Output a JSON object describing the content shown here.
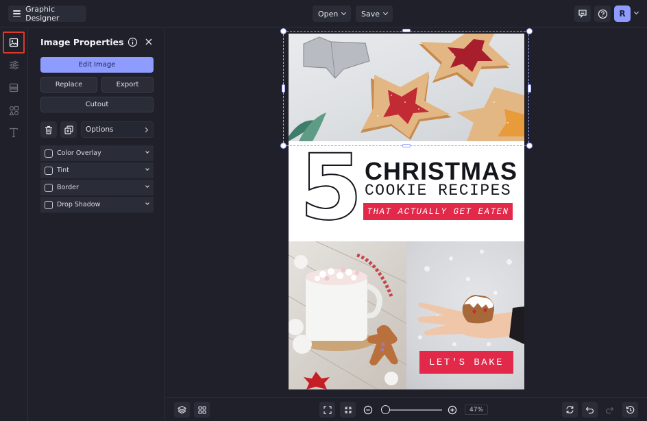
{
  "topbar": {
    "app_title": "Graphic Designer",
    "open_label": "Open",
    "save_label": "Save",
    "avatar_initial": "R",
    "icons": [
      "menu-icon",
      "comment-icon",
      "help-icon",
      "chevron-down-icon"
    ]
  },
  "rail": {
    "items": [
      {
        "name": "image-properties",
        "icon": "image-icon",
        "active": true
      },
      {
        "name": "adjustments",
        "icon": "sliders-icon",
        "active": false
      },
      {
        "name": "layout",
        "icon": "layout-icon",
        "active": false
      },
      {
        "name": "graphics",
        "icon": "shapes-icon",
        "active": false
      },
      {
        "name": "text",
        "icon": "text-icon",
        "active": false
      }
    ]
  },
  "panel": {
    "title": "Image Properties",
    "edit_image_label": "Edit Image",
    "replace_label": "Replace",
    "export_label": "Export",
    "cutout_label": "Cutout",
    "options_label": "Options",
    "effects": [
      {
        "label": "Color Overlay",
        "checked": false
      },
      {
        "label": "Tint",
        "checked": false
      },
      {
        "label": "Border",
        "checked": false
      },
      {
        "label": "Drop Shadow",
        "checked": false
      }
    ]
  },
  "design": {
    "number": "5",
    "headline": "CHRISTMAS",
    "subheadline": "COOKIE RECIPES",
    "tagline": "THAT ACTUALLY GET EATEN",
    "cta": "LET'S BAKE",
    "accent_color": "#e2294a",
    "images": [
      {
        "name": "star-cookies-photo",
        "description": "Star-shaped jam cookies with powdered sugar"
      },
      {
        "name": "hot-cocoa-photo",
        "description": "Mug of hot cocoa with marshmallows and gingerbread man"
      },
      {
        "name": "gingerbread-hand-photo",
        "description": "Hand holding a gingerbread house cookie"
      }
    ]
  },
  "bottombar": {
    "zoom_value": "47%",
    "zoom_fraction": 0.05
  },
  "colors": {
    "background": "#1f2029",
    "accent": "#8f9cff",
    "selection_highlight": "#e0392b"
  }
}
